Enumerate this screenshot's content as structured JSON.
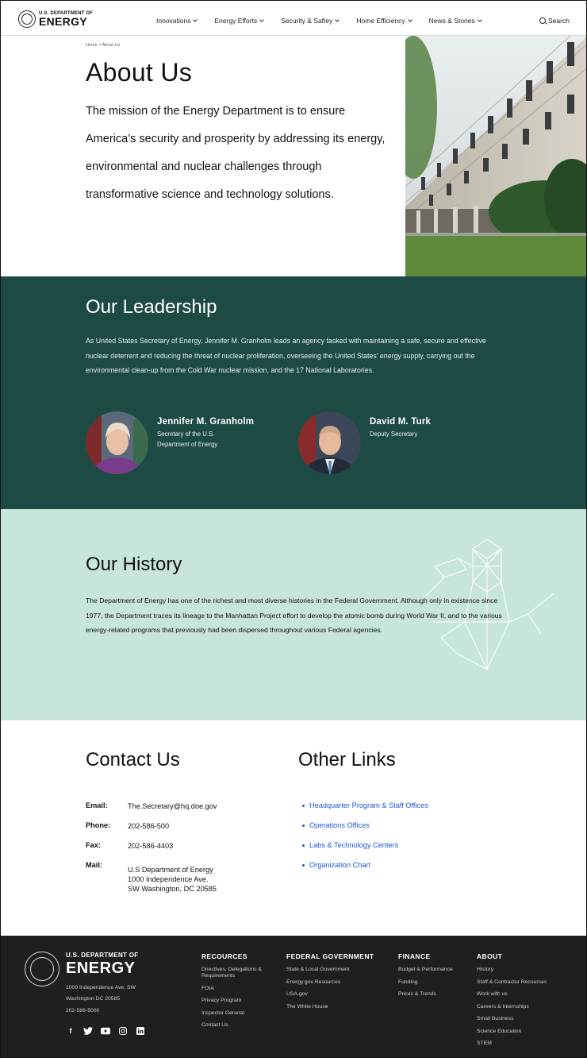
{
  "header": {
    "logo_small": "U.S. DEPARTMENT OF",
    "logo_big": "ENERGY",
    "nav": [
      "Innovations",
      "Energy Efforts",
      "Security & Saftey",
      "Home Efficiency",
      "News & Stories"
    ],
    "search_label": "Search"
  },
  "hero": {
    "breadcrumb": "Home > About Us",
    "title": "About Us",
    "mission": "The mission of the Energy Department is to ensure America’s security and prosperity by addressing its energy, environmental and nuclear challenges through transformative science and technology solutions."
  },
  "leadership": {
    "title": "Our Leadership",
    "text": "As United States Secretary of Energy, Jennifer M. Granholm leads an agency tasked with maintaining a safe, secure and effective nuclear deterrent and reducing the threat of nuclear proliferation, overseeing the United States’ energy supply, carrying out the environmental clean-up from the Cold War nuclear mission, and the 17 National Laboratories.",
    "people": [
      {
        "name": "Jennifer M. Granholm",
        "role": "Secretary of the U.S. Department of Energy"
      },
      {
        "name": "David M. Turk",
        "role": "Deputy Secretary"
      }
    ]
  },
  "history": {
    "title": "Our History",
    "text": "The Department of Energy has one of the richest and most diverse histories in the Federal Government. Although only in existence since 1977, the Department traces its lineage to the Manhattan Project effort to develop the atomic bomb during World War II, and to the various energy-related programs that previously had been dispersed throughout various Federal agencies."
  },
  "contact": {
    "title": "Contact Us",
    "email_label": "Email:",
    "email": "The.Secretary@hq.doe.gov",
    "phone_label": "Phone:",
    "phone": "202-586-500",
    "fax_label": "Fax:",
    "fax": "202-586-4403",
    "mail_label": "Mail:",
    "mail_lines": [
      "U.S Department of Energy",
      "1000 Independence Ave.",
      "SW Washington, DC 20585"
    ]
  },
  "other_links": {
    "title": "Other Links",
    "items": [
      "Headquarter Program & Staff Offices",
      "Operations Offices",
      "Labs & Technology Centers",
      "Organization Chart"
    ]
  },
  "footer": {
    "logo_small": "U.S. DEPARTMENT OF",
    "logo_big": "ENERGY",
    "address": [
      "1000 Independence Ave. SW",
      "Washington DC 20585",
      "202-586-5000"
    ],
    "social_icons": [
      "facebook-icon",
      "twitter-icon",
      "youtube-icon",
      "instagram-icon",
      "linkedin-icon"
    ],
    "columns": [
      {
        "title": "RECOURCES",
        "items": [
          "Directives, Delegations & Requirements",
          "FOIA",
          "Privacy Program",
          "Inspector General",
          "Contact Us"
        ]
      },
      {
        "title": "FEDERAL GOVERNMENT",
        "items": [
          "State & Local Government",
          "Energy.gov Resources",
          "USA.gov",
          "The White House"
        ]
      },
      {
        "title": "FINANCE",
        "items": [
          "Budget & Performance",
          "Funding",
          "Prices & Trends"
        ]
      },
      {
        "title": "ABOUT",
        "items": [
          "History",
          "Staff & Contractor Recources",
          "Work with us",
          "Careers & Internships",
          "Small Business",
          "Science Education",
          "STEM"
        ]
      }
    ]
  },
  "colors": {
    "leadership_bg": "#1e4a44",
    "history_bg": "#c8e5da",
    "footer_bg": "#1f1f1f",
    "accent": "#3fc9a0",
    "link": "#1a56db"
  }
}
